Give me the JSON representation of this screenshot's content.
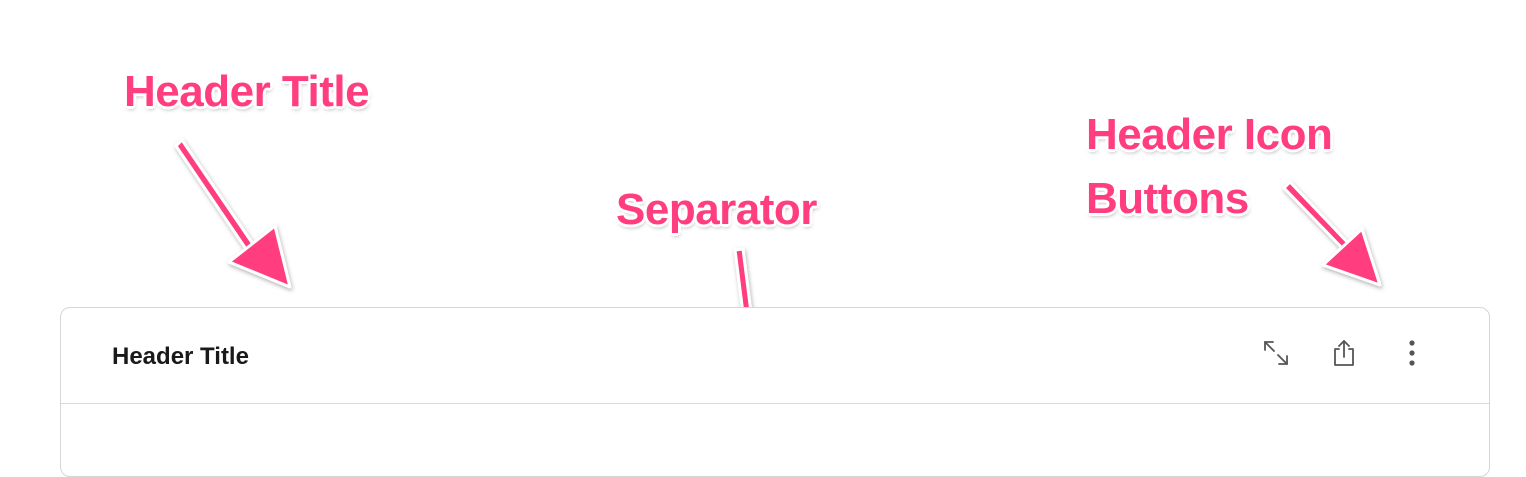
{
  "annotations": {
    "header_title": "Header Title",
    "separator": "Separator",
    "header_icon_buttons_line1": "Header Icon",
    "header_icon_buttons_line2": "Buttons",
    "color": "#ff3d7f"
  },
  "card": {
    "title": "Header Title",
    "actions": [
      {
        "icon": "expand-icon"
      },
      {
        "icon": "share-icon"
      },
      {
        "icon": "more-vertical-icon"
      }
    ]
  }
}
